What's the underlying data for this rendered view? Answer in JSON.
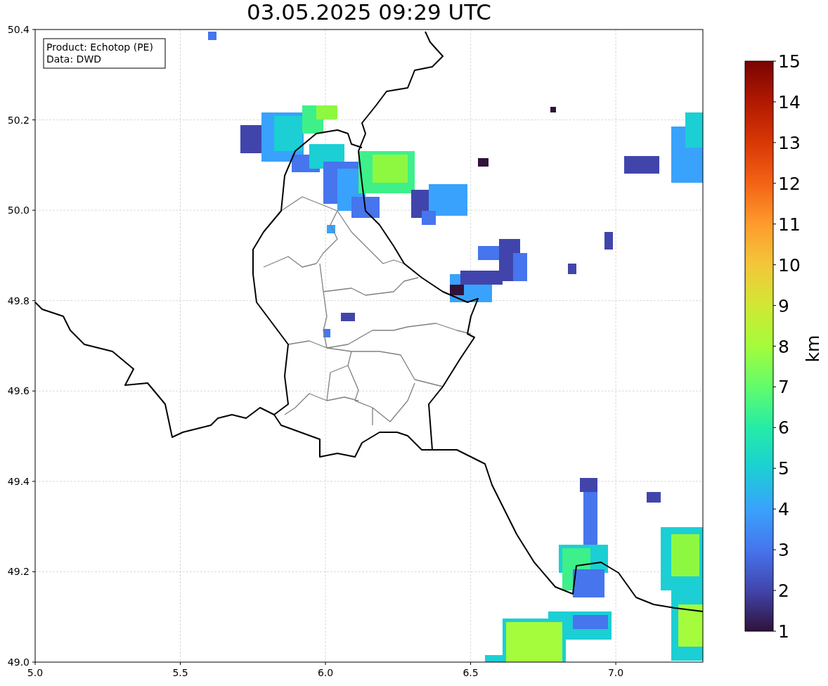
{
  "title": "03.05.2025 09:29 UTC",
  "legend": [
    "Product: Echotop (PE)",
    "Data: DWD"
  ],
  "x_ticks": [
    "5.0",
    "5.5",
    "6.0",
    "6.5",
    "7.0"
  ],
  "y_ticks": [
    "50.4",
    "50.2",
    "50.0",
    "49.8",
    "49.6",
    "49.4",
    "49.2",
    "49.0"
  ],
  "colorbar": {
    "label": "km",
    "ticks": [
      "15",
      "14",
      "13",
      "12",
      "11",
      "10",
      "9",
      "8",
      "7",
      "6",
      "5",
      "4",
      "3",
      "2",
      "1"
    ]
  }
}
